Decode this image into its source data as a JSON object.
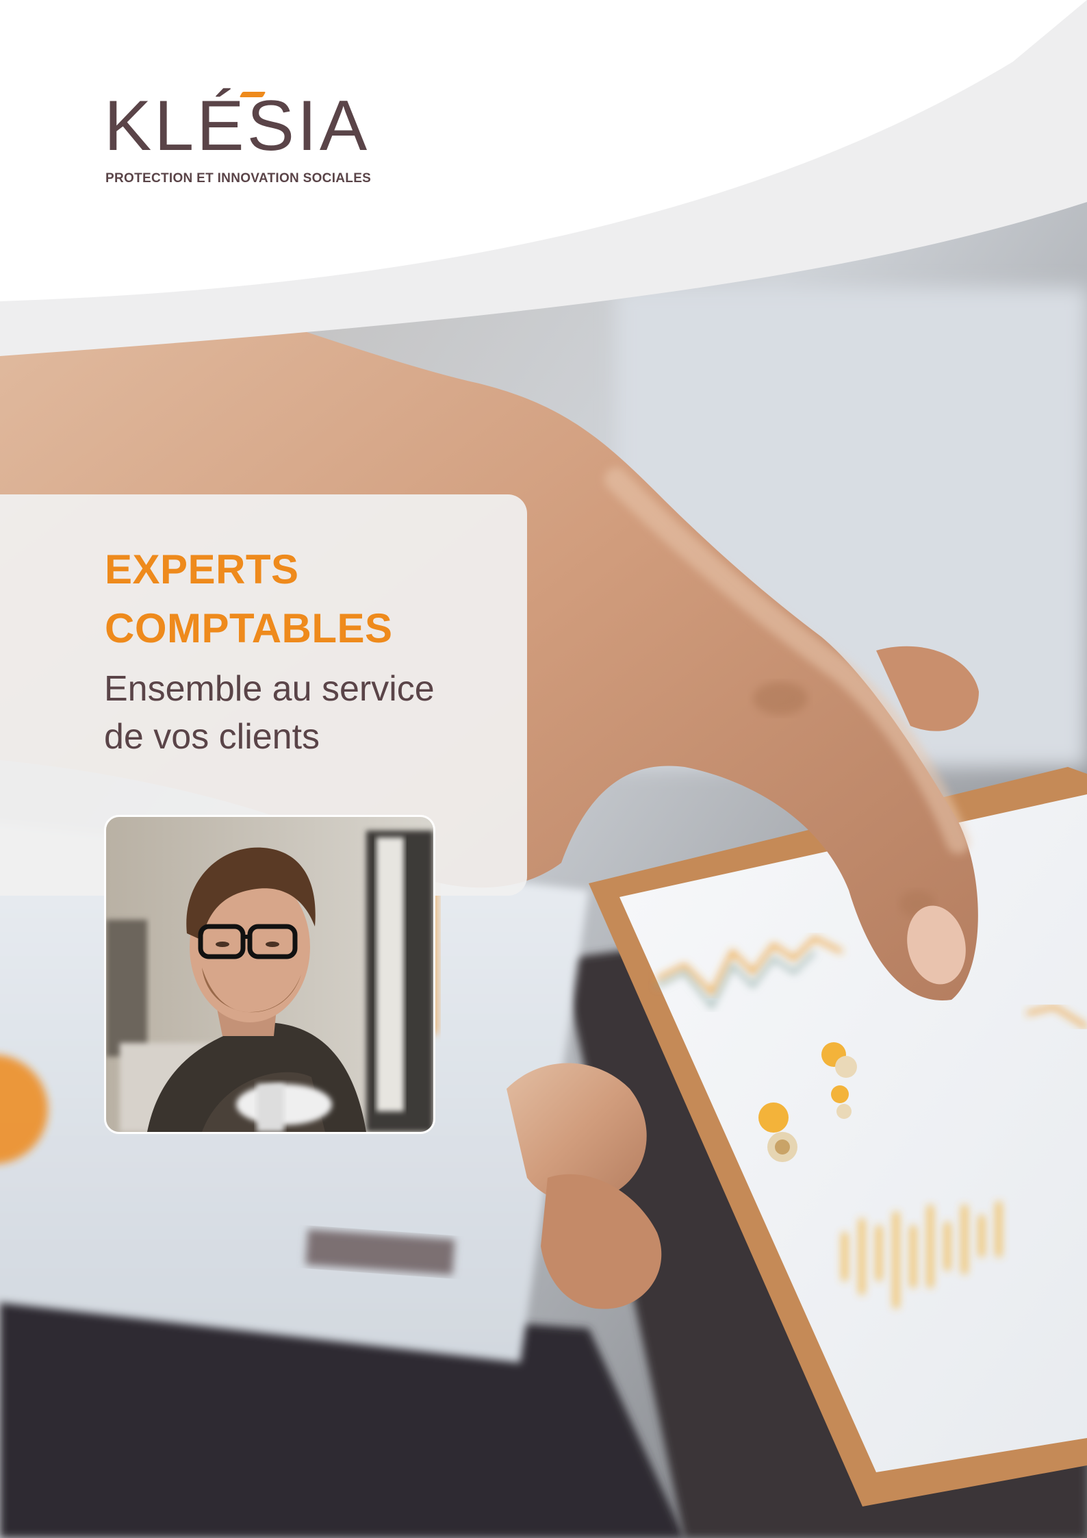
{
  "brand": {
    "logo_text": "KLÉSIA",
    "tagline": "PROTECTION ET INNOVATION SOCIALES",
    "accent_color": "#ee8a1c",
    "text_color": "#5a4448"
  },
  "title": {
    "line1": "EXPERTS",
    "line2": "COMPTABLES"
  },
  "subtitle": {
    "line1": "Ensemble au service",
    "line2": "de vos clients"
  },
  "images": {
    "hero": "hand-touching-smartphone-photo",
    "portrait": "man-with-glasses-photo"
  }
}
